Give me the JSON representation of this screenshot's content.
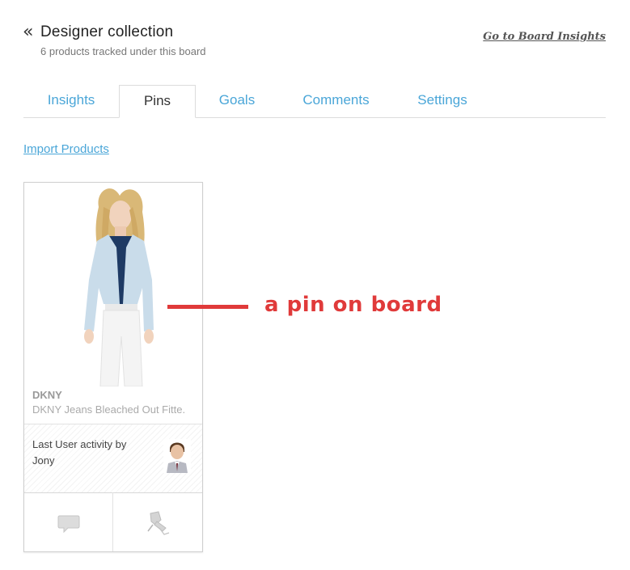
{
  "header": {
    "back_glyph": "«",
    "title": "Designer collection",
    "subtitle": "6 products tracked under this board",
    "insights_link": "Go to Board Insights"
  },
  "tabs": [
    {
      "label": "Insights",
      "active": false
    },
    {
      "label": "Pins",
      "active": true
    },
    {
      "label": "Goals",
      "active": false
    },
    {
      "label": "Comments",
      "active": false
    },
    {
      "label": "Settings",
      "active": false
    }
  ],
  "import_link": "Import Products",
  "card": {
    "brand": "DKNY",
    "product_name": "DKNY Jeans Bleached Out Fitte.",
    "activity_label": "Last User activity by",
    "activity_user": "Jony",
    "actions": [
      {
        "icon": "comment-icon"
      },
      {
        "icon": "pin-icon"
      }
    ]
  },
  "annotation": {
    "text": "a pin on board",
    "color": "#e03a3a"
  },
  "colors": {
    "link": "#4aa6d8",
    "active_tab_text": "#333333",
    "annotation": "#e03a3a"
  }
}
